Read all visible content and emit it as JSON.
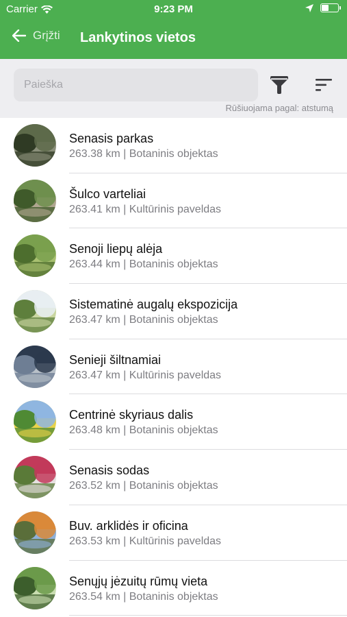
{
  "status_bar": {
    "carrier": "Carrier",
    "time": "9:23 PM",
    "battery_level": 0.4
  },
  "nav": {
    "back_label": "Grįžti",
    "title": "Lankytinos vietos"
  },
  "search": {
    "placeholder": "Paieška",
    "value": ""
  },
  "sort_info": "Rūšiuojama pagal: atstumą",
  "items": [
    {
      "title": "Senasis parkas",
      "subtitle": "263.38 km | Botaninis objektas",
      "colors": [
        "#5d6a4a",
        "#2f3a24",
        "#8a8f7a"
      ]
    },
    {
      "title": "Šulco varteliai",
      "subtitle": "263.41 km | Kultūrinis paveldas",
      "colors": [
        "#6e8f4e",
        "#3f5a2a",
        "#b0a690"
      ]
    },
    {
      "title": "Senoji liepų alėja",
      "subtitle": "263.44 km | Botaninis objektas",
      "colors": [
        "#7aa04e",
        "#4d6e2e",
        "#a8c070"
      ]
    },
    {
      "title": "Sistematinė augalų ekspozicija",
      "subtitle": "263.47 km | Botaninis objektas",
      "colors": [
        "#e8eef2",
        "#5e7f3c",
        "#c9d6a0"
      ]
    },
    {
      "title": "Senieji šiltnamiai",
      "subtitle": "263.47 km | Kultūrinis paveldas",
      "colors": [
        "#2c3a4e",
        "#6e7e94",
        "#b8c0c8"
      ]
    },
    {
      "title": "Centrinė skyriaus dalis",
      "subtitle": "263.48 km | Botaninis objektas",
      "colors": [
        "#8fb6e0",
        "#4f8a34",
        "#e8d24a"
      ]
    },
    {
      "title": "Senasis sodas",
      "subtitle": "263.52 km | Botaninis objektas",
      "colors": [
        "#c23a5a",
        "#5a7a38",
        "#e6e0e0"
      ]
    },
    {
      "title": "Buv. arklidės ir oficina",
      "subtitle": "263.53 km | Kultūrinis paveldas",
      "colors": [
        "#d9893a",
        "#5a6e3a",
        "#8fb0d8"
      ]
    },
    {
      "title": "Senųjų jėzuitų rūmų vieta",
      "subtitle": "263.54 km | Botaninis objektas",
      "colors": [
        "#6b9a4a",
        "#3c5e2c",
        "#c9ddb0"
      ]
    }
  ]
}
